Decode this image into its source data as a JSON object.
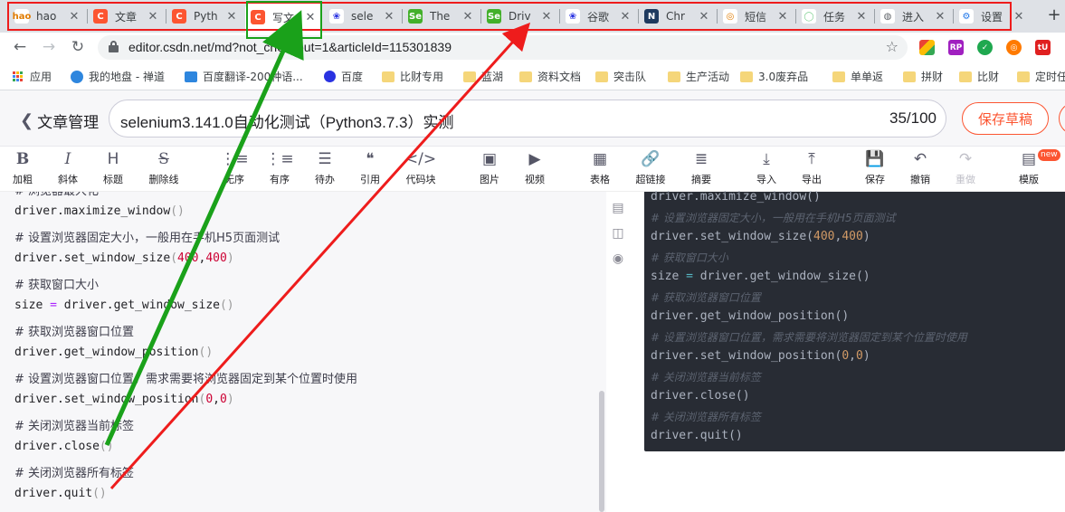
{
  "tabs": [
    {
      "title": "hao",
      "fav_color": "#4caf50",
      "fav_text": "hao",
      "fav_text_color": "#e07b00",
      "fav_bg": "#ffffff"
    },
    {
      "title": "文章",
      "fav_color": "#fc5531",
      "fav_text": "C"
    },
    {
      "title": "Pyth",
      "fav_color": "#fc5531",
      "fav_text": "C"
    },
    {
      "title": "写文",
      "fav_color": "#fc5531",
      "fav_text": "C",
      "active": true
    },
    {
      "title": "sele",
      "fav_color": "#2932e1",
      "fav_text": "❀",
      "fav_bg": "#ffffff"
    },
    {
      "title": "The",
      "fav_color": "#43b02a",
      "fav_text": "Se"
    },
    {
      "title": "Driv",
      "fav_color": "#43b02a",
      "fav_text": "Se"
    },
    {
      "title": "谷歌",
      "fav_color": "#2932e1",
      "fav_text": "❀",
      "fav_bg": "#ffffff"
    },
    {
      "title": "Chr",
      "fav_color": "#1e3a5f",
      "fav_text": "N"
    },
    {
      "title": "短信",
      "fav_color": "#e07b00",
      "fav_text": "◎",
      "fav_bg": "#ffffff"
    },
    {
      "title": "任务",
      "fav_color": "#7ccf8f",
      "fav_text": "◯",
      "fav_bg": "#ffffff"
    },
    {
      "title": "进入",
      "fav_color": "#5f6368",
      "fav_text": "◍",
      "fav_bg": "#ffffff"
    },
    {
      "title": "设置",
      "fav_color": "#1a73e8",
      "fav_text": "⚙",
      "fav_bg": "#ffffff"
    }
  ],
  "address_bar": {
    "url": "editor.csdn.net/md?not_checkout=1&articleId=115301839"
  },
  "bookmarks": [
    {
      "label": "应用",
      "icon": "apps-grid-icon"
    },
    {
      "label": "我的地盘 - 禅道",
      "icon": "globe-icon"
    },
    {
      "label": "百度翻译-200种语...",
      "icon": "translate-icon"
    },
    {
      "label": "百度",
      "icon": "baidu-paw-icon"
    },
    {
      "label": "比财专用",
      "icon": "folder-icon"
    },
    {
      "label": "蓝湖",
      "icon": "folder-icon"
    },
    {
      "label": "资料文档",
      "icon": "folder-icon"
    },
    {
      "label": "突击队",
      "icon": "folder-icon"
    },
    {
      "label": "生产活动",
      "icon": "folder-icon"
    },
    {
      "label": "3.0废弃品",
      "icon": "folder-icon"
    },
    {
      "label": "单单返",
      "icon": "folder-icon"
    },
    {
      "label": "拼财",
      "icon": "folder-icon"
    },
    {
      "label": "比财",
      "icon": "folder-icon"
    },
    {
      "label": "定时任",
      "icon": "folder-icon"
    }
  ],
  "header": {
    "back_label": "文章管理",
    "title": "selenium3.141.0自动化测试（Python3.7.3）实测",
    "title_count": "35/100",
    "save_draft_label": "保存草稿"
  },
  "toolbar": [
    {
      "label": "加粗",
      "icon": "B",
      "name": "bold"
    },
    {
      "label": "斜体",
      "icon": "I",
      "name": "italic"
    },
    {
      "label": "标题",
      "icon": "H",
      "name": "heading"
    },
    {
      "label": "删除线",
      "icon": "S",
      "name": "strikethrough"
    },
    {
      "label": "无序",
      "icon": "⋮≡",
      "name": "unordered-list"
    },
    {
      "label": "有序",
      "icon": "⋮≡",
      "name": "ordered-list"
    },
    {
      "label": "待办",
      "icon": "☰",
      "name": "todo"
    },
    {
      "label": "引用",
      "icon": "❝",
      "name": "quote"
    },
    {
      "label": "代码块",
      "icon": "</>",
      "name": "code-block"
    },
    {
      "label": "图片",
      "icon": "▣",
      "name": "image"
    },
    {
      "label": "视频",
      "icon": "▶",
      "name": "video"
    },
    {
      "label": "表格",
      "icon": "▦",
      "name": "table"
    },
    {
      "label": "超链接",
      "icon": "🔗",
      "name": "link"
    },
    {
      "label": "摘要",
      "icon": "≣",
      "name": "summary"
    },
    {
      "label": "导入",
      "icon": "⤓",
      "name": "import"
    },
    {
      "label": "导出",
      "icon": "⤒",
      "name": "export"
    },
    {
      "label": "保存",
      "icon": "💾",
      "name": "save"
    },
    {
      "label": "撤销",
      "icon": "↶",
      "name": "undo"
    },
    {
      "label": "重做",
      "icon": "↷",
      "name": "redo",
      "disabled": true
    },
    {
      "label": "模版",
      "icon": "▤",
      "name": "template"
    }
  ],
  "new_badge": "new",
  "editor_lines": [
    {
      "type": "code",
      "parts": [
        [
          "t",
          "driver.maximize_window"
        ],
        [
          "p",
          "()"
        ]
      ]
    },
    {
      "type": "cmt",
      "parts": [
        [
          "t",
          "# 设置浏览器固定大小，一般用在手机H5页面测试"
        ]
      ]
    },
    {
      "type": "code",
      "parts": [
        [
          "t",
          "driver.set_window_size"
        ],
        [
          "p",
          "("
        ],
        [
          "n",
          "400"
        ],
        [
          "t",
          ","
        ],
        [
          "n",
          "400"
        ],
        [
          "p",
          ")"
        ]
      ]
    },
    {
      "type": "cmt",
      "parts": [
        [
          "t",
          "# 获取窗口大小"
        ]
      ]
    },
    {
      "type": "code",
      "parts": [
        [
          "t",
          "size "
        ],
        [
          "o",
          "="
        ],
        [
          "t",
          " driver.get_window_size"
        ],
        [
          "p",
          "()"
        ]
      ]
    },
    {
      "type": "cmt",
      "parts": [
        [
          "t",
          "# 获取浏览器窗口位置"
        ]
      ]
    },
    {
      "type": "code",
      "parts": [
        [
          "t",
          "driver.get_window_position"
        ],
        [
          "p",
          "()"
        ]
      ]
    },
    {
      "type": "cmt",
      "parts": [
        [
          "t",
          "# 设置浏览器窗口位置，需求需要将浏览器固定到某个位置时使用"
        ]
      ]
    },
    {
      "type": "code",
      "parts": [
        [
          "t",
          "driver.set_window_position"
        ],
        [
          "p",
          "("
        ],
        [
          "n",
          "0"
        ],
        [
          "t",
          ","
        ],
        [
          "n",
          "0"
        ],
        [
          "p",
          ")"
        ]
      ]
    },
    {
      "type": "cmt",
      "parts": [
        [
          "t",
          "# 关闭浏览器当前标签"
        ]
      ]
    },
    {
      "type": "code",
      "parts": [
        [
          "t",
          "driver.close"
        ],
        [
          "p",
          "()"
        ]
      ]
    },
    {
      "type": "cmt",
      "parts": [
        [
          "t",
          "# 关闭浏览器所有标签"
        ]
      ]
    },
    {
      "type": "code",
      "parts": [
        [
          "t",
          "driver.quit"
        ],
        [
          "p",
          "()"
        ]
      ]
    }
  ],
  "preview_lines": [
    {
      "type": "code",
      "parts": [
        [
          "t",
          "driver.maximize_window()"
        ]
      ]
    },
    {
      "type": "cmt",
      "parts": [
        [
          "t",
          "# 设置浏览器固定大小，一般用在手机H5页面测试"
        ]
      ]
    },
    {
      "type": "code",
      "parts": [
        [
          "t",
          "driver.set_window_size("
        ],
        [
          "n",
          "400"
        ],
        [
          "t",
          ","
        ],
        [
          "n",
          "400"
        ],
        [
          "t",
          ")"
        ]
      ]
    },
    {
      "type": "cmt",
      "parts": [
        [
          "t",
          "# 获取窗口大小"
        ]
      ]
    },
    {
      "type": "code",
      "parts": [
        [
          "t",
          "size "
        ],
        [
          "o",
          "="
        ],
        [
          "t",
          " driver.get_window_size()"
        ]
      ]
    },
    {
      "type": "cmt",
      "parts": [
        [
          "t",
          "# 获取浏览器窗口位置"
        ]
      ]
    },
    {
      "type": "code",
      "parts": [
        [
          "t",
          "driver.get_window_position()"
        ]
      ]
    },
    {
      "type": "cmt",
      "parts": [
        [
          "t",
          "# 设置浏览器窗口位置，需求需要将浏览器固定到某个位置时使用"
        ]
      ]
    },
    {
      "type": "code",
      "parts": [
        [
          "t",
          "driver.set_window_position("
        ],
        [
          "n",
          "0"
        ],
        [
          "t",
          ","
        ],
        [
          "n",
          "0"
        ],
        [
          "t",
          ")"
        ]
      ]
    },
    {
      "type": "cmt",
      "parts": [
        [
          "t",
          "# 关闭浏览器当前标签"
        ]
      ]
    },
    {
      "type": "code",
      "parts": [
        [
          "t",
          "driver.close()"
        ]
      ]
    },
    {
      "type": "cmt",
      "parts": [
        [
          "t",
          "# 关闭浏览器所有标签"
        ]
      ]
    },
    {
      "type": "code",
      "parts": [
        [
          "t",
          "driver.quit()"
        ]
      ]
    }
  ],
  "colors": {
    "annotation_red": "#ee1c1c",
    "annotation_green": "#1aa11a",
    "csdn_accent": "#fc5531"
  }
}
